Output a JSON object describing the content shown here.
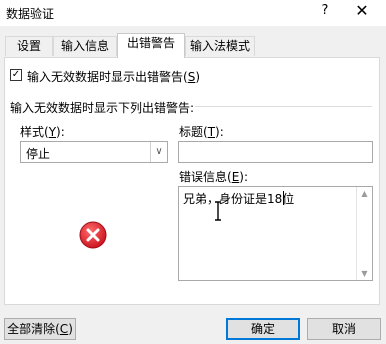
{
  "window": {
    "title": "数据验证",
    "help": "?",
    "close": "✕"
  },
  "tabs": [
    {
      "label": "设置",
      "active": false
    },
    {
      "label": "输入信息",
      "active": false
    },
    {
      "label": "出错警告",
      "active": true
    },
    {
      "label": "输入法模式",
      "active": false
    }
  ],
  "alert": {
    "show_checkbox": {
      "checked": true,
      "mark": "✓",
      "label": "输入无效数据时显示出错警告(",
      "accel": "S",
      "label_end": ")"
    },
    "group_label": "输入无效数据时显示下列出错警告:",
    "style": {
      "label": "样式(",
      "accel": "Y",
      "label_end": "):",
      "value": "停止",
      "arrow": "∨"
    },
    "title": {
      "label": "标题(",
      "accel": "T",
      "label_end": "):",
      "value": ""
    },
    "message": {
      "label": "错误信息(",
      "accel": "E",
      "label_end": "):",
      "value": "兄弟，身份证是18位"
    },
    "icon": "stop-error-icon"
  },
  "footer": {
    "clear_all": {
      "label": "全部清除(",
      "accel": "C",
      "label_end": ")"
    },
    "ok": "确定",
    "cancel": "取消"
  },
  "colors": {
    "stop_icon": "#e0202c",
    "default_button_border": "#0078d7"
  }
}
